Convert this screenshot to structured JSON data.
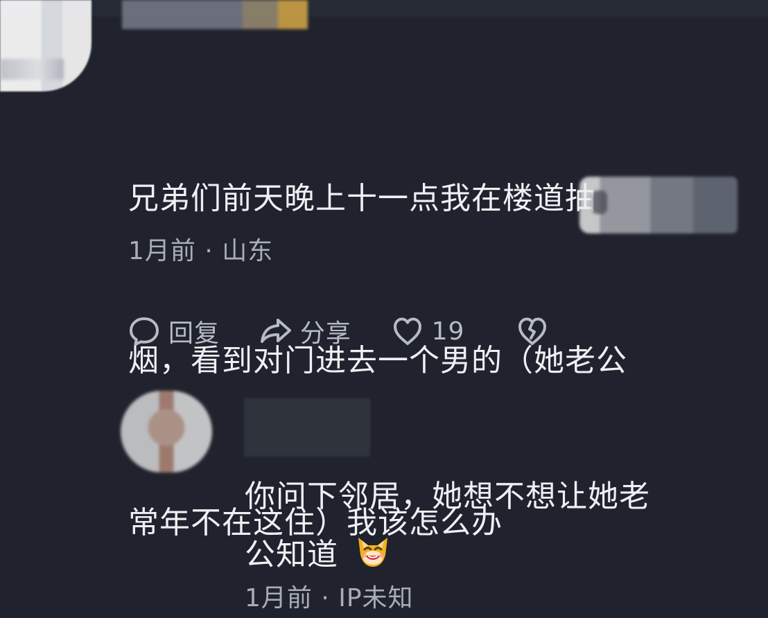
{
  "comment": {
    "line1": "兄弟们前天晚上十一点我在楼道抽",
    "line2": "烟，看到对门进去一个男的（她老公",
    "line3": "常年不在这住）我该怎么办",
    "meta": "1月前 · 山东"
  },
  "actions": {
    "reply_label": "回复",
    "share_label": "分享",
    "like_count": "19"
  },
  "reply": {
    "line1": "你问下邻居，她想不想让她老",
    "line2": "公知道",
    "meta": "1月前 · IP未知"
  },
  "icons": {
    "reply_icon": "chat-bubble-icon",
    "share_icon": "share-arrow-icon",
    "like_icon": "heart-icon",
    "dislike_icon": "broken-heart-icon",
    "emoji_icon": "laughing-cat-emoji"
  },
  "colors": {
    "background": "#20232d",
    "primary_text": "#eef0f4",
    "secondary_text": "#a9adb7",
    "icon": "#b7bbc4"
  }
}
